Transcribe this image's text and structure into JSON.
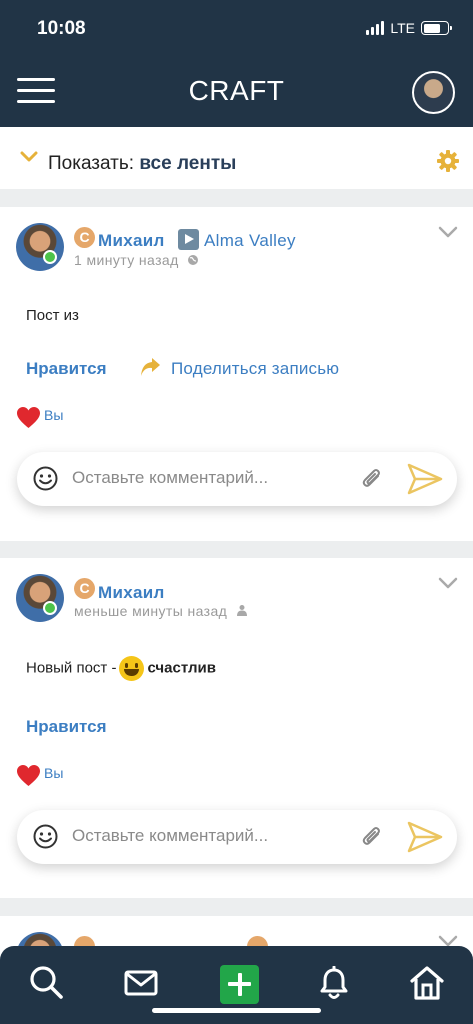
{
  "status_bar": {
    "time": "10:08",
    "network": "LTE"
  },
  "header": {
    "title": "CRAFT"
  },
  "filter": {
    "label": "Показать:",
    "value": "все ленты"
  },
  "posts": [
    {
      "author": "Михаил",
      "badge": "C",
      "group": "Alma Valley",
      "time": "1 минуту назад",
      "text": "Пост из",
      "like_label": "Нравится",
      "share_label": "Поделиться записью",
      "likers": "Вы",
      "comment_placeholder": "Оставьте комментарий..."
    },
    {
      "author": "Михаил",
      "badge": "C",
      "time": "меньше минуты назад",
      "text": "Новый пост -",
      "mood": "счастлив",
      "like_label": "Нравится",
      "likers": "Вы",
      "comment_placeholder": "Оставьте комментарий..."
    }
  ],
  "colors": {
    "header_bg": "#213446",
    "accent": "#3c7ec2",
    "gold": "#e6b23a",
    "create_green": "#22a649"
  }
}
